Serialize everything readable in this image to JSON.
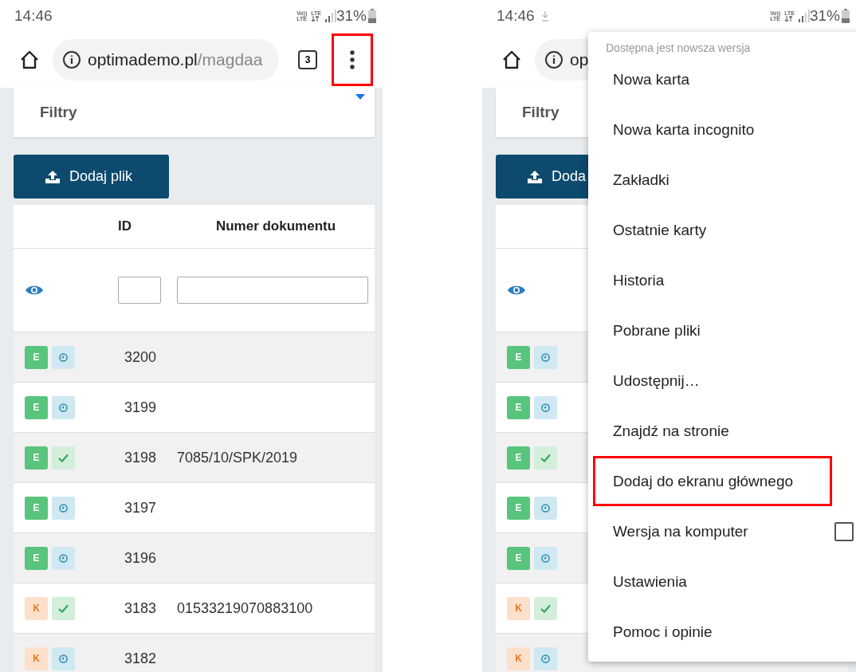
{
  "screens": [
    {
      "status_bar": {
        "time": "14:46",
        "volte_top": "Vo))",
        "volte_bottom": "LTE",
        "data_label": "LTE",
        "battery": "31%"
      },
      "browser": {
        "url_host": "optimademo.pl",
        "url_path": "/magdaa",
        "tab_count": "3",
        "menu_button_highlighted": true
      },
      "page": {
        "filter_title": "Filtry",
        "upload_button": "Dodaj plik",
        "columns": [
          "ID",
          "Numer dokumentu"
        ],
        "rows": [
          {
            "badge": "E",
            "color": "#58c47c",
            "done": false,
            "id": "3200"
          },
          {
            "badge": "E",
            "color": "#58c47c",
            "done": false,
            "id": "3199"
          },
          {
            "badge": "E",
            "color": "#58c47c",
            "done": true,
            "id": "3198",
            "document": "7085/10/SPK/2019"
          },
          {
            "badge": "E",
            "color": "#58c47c",
            "done": false,
            "id": "3197"
          },
          {
            "badge": "E",
            "color": "#58c47c",
            "done": false,
            "id": "3196"
          },
          {
            "badge": "K",
            "color": "#fde0cc",
            "done": true,
            "id": "3183",
            "document": "01533219070883100"
          },
          {
            "badge": "K",
            "color": "#fde0cc",
            "done": false,
            "id": "3182"
          }
        ]
      }
    },
    {
      "status_bar": {
        "time": "14:46",
        "download_pending": true,
        "volte_top": "Vo))",
        "volte_bottom": "LTE",
        "data_label": "LTE",
        "battery": "31%"
      },
      "browser": {
        "url_host": "op"
      },
      "page": {
        "filter_title": "Filtry",
        "upload_button": "Doda",
        "rows": [
          {
            "badge": "E",
            "color": "#58c47c",
            "done": false
          },
          {
            "badge": "E",
            "color": "#58c47c",
            "done": false
          },
          {
            "badge": "E",
            "color": "#58c47c",
            "done": true
          },
          {
            "badge": "E",
            "color": "#58c47c",
            "done": false
          },
          {
            "badge": "E",
            "color": "#58c47c",
            "done": false
          },
          {
            "badge": "K",
            "color": "#fde0cc",
            "done": true
          },
          {
            "badge": "K",
            "color": "#fde0cc",
            "done": false
          }
        ]
      },
      "menu": {
        "notice": "Dostępna jest nowsza wersja",
        "items": [
          {
            "kind": "plain",
            "label": "Nowa karta",
            "highlighted": false
          },
          {
            "kind": "plain",
            "label": "Nowa karta incognito",
            "highlighted": false
          },
          {
            "kind": "plain",
            "label": "Zakładki",
            "highlighted": false
          },
          {
            "kind": "plain",
            "label": "Ostatnie karty",
            "highlighted": false
          },
          {
            "kind": "plain",
            "label": "Historia",
            "highlighted": false
          },
          {
            "kind": "plain",
            "label": "Pobrane pliki",
            "highlighted": false
          },
          {
            "kind": "plain",
            "label": "Udostępnij…",
            "highlighted": false
          },
          {
            "kind": "plain",
            "label": "Znajdź na stronie",
            "highlighted": false
          },
          {
            "kind": "plain",
            "label": "Dodaj do ekranu głównego",
            "highlighted": true
          },
          {
            "kind": "checkbox",
            "label": "Wersja na komputer",
            "highlighted": false,
            "checked": false
          },
          {
            "kind": "plain",
            "label": "Ustawienia",
            "highlighted": false
          },
          {
            "kind": "plain",
            "label": "Pomoc i opinie",
            "highlighted": false
          }
        ]
      }
    }
  ]
}
